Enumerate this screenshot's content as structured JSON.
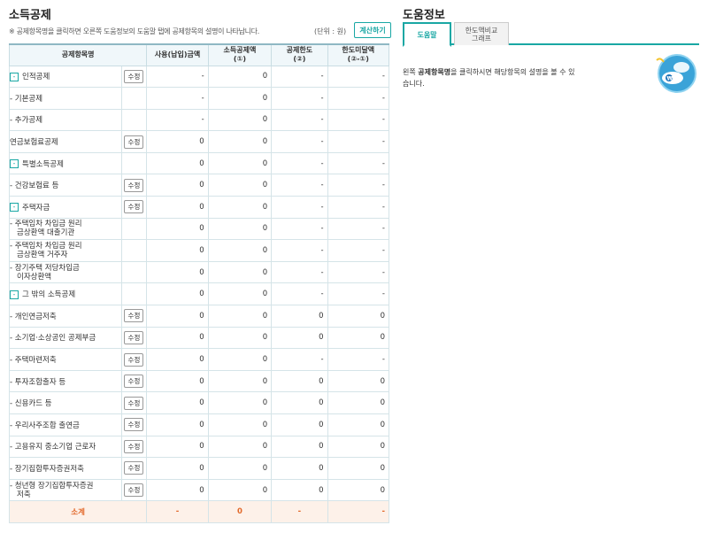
{
  "left": {
    "title": "소득공제",
    "note": "※ 공제항목명을 클릭하면 오른쪽 도움정보의 도움말 탭에 공제항목의 설명이 나타납니다.",
    "unit": "(단위 : 원)",
    "calc_label": "계산하기",
    "headers": {
      "item": "공제항목명",
      "used": "사용(납입)금액",
      "deduction_line1": "소득공제액",
      "deduction_line2": "(①)",
      "limit_line1": "공제한도",
      "limit_line2": "(②)",
      "excess_line1": "한도미달액",
      "excess_line2": "(②-①)"
    },
    "edit_label": "수정",
    "toggle_label": "-",
    "rows": [
      {
        "name": "인적공제",
        "level": 0,
        "toggle": true,
        "edit": true,
        "used": "-",
        "ded": "0",
        "lim": "-",
        "exc": "-"
      },
      {
        "name": "- 기본공제",
        "level": 1,
        "toggle": false,
        "edit": false,
        "used": "-",
        "ded": "0",
        "lim": "-",
        "exc": "-"
      },
      {
        "name": "- 추가공제",
        "level": 1,
        "toggle": false,
        "edit": false,
        "used": "-",
        "ded": "0",
        "lim": "-",
        "exc": "-"
      },
      {
        "name": "연금보험료공제",
        "level": 0,
        "toggle": false,
        "edit": true,
        "used": "0",
        "ded": "0",
        "lim": "-",
        "exc": "-"
      },
      {
        "name": "특별소득공제",
        "level": 0,
        "toggle": true,
        "edit": false,
        "used": "0",
        "ded": "0",
        "lim": "-",
        "exc": "-"
      },
      {
        "name": "- 건강보험료 등",
        "level": 1,
        "toggle": false,
        "edit": true,
        "used": "0",
        "ded": "0",
        "lim": "-",
        "exc": "-"
      },
      {
        "name": "주택자금",
        "level": 2,
        "toggle": true,
        "edit": true,
        "used": "0",
        "ded": "0",
        "lim": "-",
        "exc": "-"
      },
      {
        "name": "- 주택임차 차입금 원리금상환액 대출기관",
        "line1": "- 주택임차 차입금 원리",
        "line2": "금상환액 대출기관",
        "level": 3,
        "toggle": false,
        "edit": false,
        "used": "0",
        "ded": "0",
        "lim": "-",
        "exc": "-"
      },
      {
        "name": "- 주택임차 차입금 원리금상환액 거주자",
        "line1": "- 주택임차 차입금 원리",
        "line2": "금상환액 거주자",
        "level": 3,
        "toggle": false,
        "edit": false,
        "used": "0",
        "ded": "0",
        "lim": "-",
        "exc": "-"
      },
      {
        "name": "- 장기주택 저당차입금 이자상환액",
        "line1": "- 장기주택 저당차입금",
        "line2": "이자상환액",
        "level": 3,
        "toggle": false,
        "edit": false,
        "used": "0",
        "ded": "0",
        "lim": "-",
        "exc": "-"
      },
      {
        "name": "그 밖의 소득공제",
        "level": 0,
        "toggle": true,
        "edit": false,
        "used": "0",
        "ded": "0",
        "lim": "-",
        "exc": "-"
      },
      {
        "name": "- 개인연금저축",
        "level": 1,
        "toggle": false,
        "edit": true,
        "used": "0",
        "ded": "0",
        "lim": "0",
        "exc": "0"
      },
      {
        "name": "- 소기업·소상공인 공제부금",
        "level": 1,
        "toggle": false,
        "edit": true,
        "used": "0",
        "ded": "0",
        "lim": "0",
        "exc": "0"
      },
      {
        "name": "- 주택마련저축",
        "level": 1,
        "toggle": false,
        "edit": true,
        "used": "0",
        "ded": "0",
        "lim": "-",
        "exc": "-"
      },
      {
        "name": "- 투자조합출자 등",
        "level": 1,
        "toggle": false,
        "edit": true,
        "used": "0",
        "ded": "0",
        "lim": "0",
        "exc": "0"
      },
      {
        "name": "- 신용카드 등",
        "level": 1,
        "toggle": false,
        "edit": true,
        "used": "0",
        "ded": "0",
        "lim": "0",
        "exc": "0"
      },
      {
        "name": "- 우리사주조합 출연금",
        "level": 1,
        "toggle": false,
        "edit": true,
        "used": "0",
        "ded": "0",
        "lim": "0",
        "exc": "0"
      },
      {
        "name": "- 고용유지 중소기업 근로자",
        "level": 1,
        "toggle": false,
        "edit": true,
        "used": "0",
        "ded": "0",
        "lim": "0",
        "exc": "0"
      },
      {
        "name": "- 장기집합투자증권저축",
        "level": 1,
        "toggle": false,
        "edit": true,
        "used": "0",
        "ded": "0",
        "lim": "0",
        "exc": "0"
      },
      {
        "name": "- 청년형 장기집합투자증권저축",
        "line1": "- 청년형 장기집합투자증권",
        "line2": "저축",
        "level": 1,
        "toggle": false,
        "edit": true,
        "used": "0",
        "ded": "0",
        "lim": "0",
        "exc": "0"
      }
    ],
    "subtotal": {
      "name": "소계",
      "used": "-",
      "ded": "0",
      "lim": "-",
      "exc": "-"
    }
  },
  "right": {
    "title": "도움정보",
    "tab_help": "도움말",
    "tab_graph_line1": "한도액비교",
    "tab_graph_line2": "그래프",
    "help_pre": "왼쪽 ",
    "help_bold": "공제항목명",
    "help_post": "을 클릭하시면 해당항목의 설명을 볼 수 있습니다.",
    "mascot_icon": "mascot-icon"
  },
  "colors": {
    "accent": "#19a7a4",
    "subtotal": "#e26a2c"
  }
}
